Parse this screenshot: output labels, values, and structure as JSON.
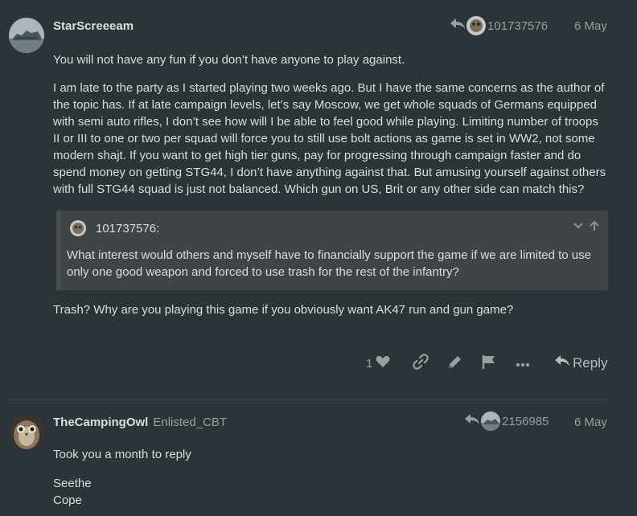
{
  "posts": [
    {
      "username": "StarScreeeam",
      "group": "",
      "reply_to_id": "101737576",
      "date": "6 May",
      "paragraphs": [
        "You will not have any fun if you don’t have anyone to play against.",
        "I am late to the party as I started playing two weeks ago. But I have the same concerns as the author of the topic has. If at late campaign levels, let’s say Moscow, we get whole squads of Germans equipped with semi auto rifles, I don’t see how will I be able to feel good while playing. Limiting number of troops II or III to one or two per squad will force you to still use bolt actions as game is set in WW2, not some modern shajt. If you want to get high tier guns, pay for progressing through campaign faster and do spend money on getting STG44, I don’t have anything against that. But amusing yourself against others with full STG44 squad is just not balanced. Which gun on US, Brit or any other side can match this?"
      ],
      "quote": {
        "author": "101737576:",
        "text": "What interest would others and myself have to financially support the game if we are limited to use only one good weapon and forced to use trash for the rest of the infantry?"
      },
      "after_quote": "Trash? Why are you playing this game if you obviously want AK47 run and gun game?",
      "actions": {
        "like_count": "1",
        "reply_label": "Reply",
        "icons": [
          "heart-icon",
          "link-icon",
          "pencil-icon",
          "flag-icon",
          "ellipsis-icon",
          "reply-arrow-icon"
        ]
      }
    },
    {
      "username": "TheCampingOwl",
      "group": "Enlisted_CBT",
      "reply_to_id": "2156985",
      "date": "6 May",
      "paragraphs": [
        "Took you a month to reply",
        "Seethe",
        "Cope"
      ]
    }
  ],
  "colors": {
    "background": "#2b3438",
    "text": "#dcdddd",
    "muted": "#9a9fa1",
    "quote_bg": "#3f4447"
  }
}
